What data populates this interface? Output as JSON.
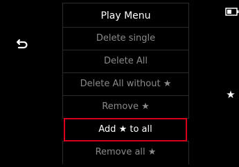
{
  "menu": {
    "title": "Play Menu",
    "items": [
      {
        "label": "Delete single"
      },
      {
        "label": "Delete All"
      },
      {
        "label": "Delete All without ★"
      },
      {
        "label": "Remove ★"
      },
      {
        "label": "Add ★ to all",
        "selected": true
      },
      {
        "label": "Remove all ★"
      }
    ]
  },
  "side": {
    "right_star": "★",
    "back_icon": "back-arrow-icon",
    "battery_icon": "battery-icon"
  },
  "colors": {
    "background": "#000000",
    "text_active": "#ffffff",
    "text_inactive": "#8a8a8a",
    "divider": "#2c2c2c",
    "selection": "#d9001b"
  }
}
